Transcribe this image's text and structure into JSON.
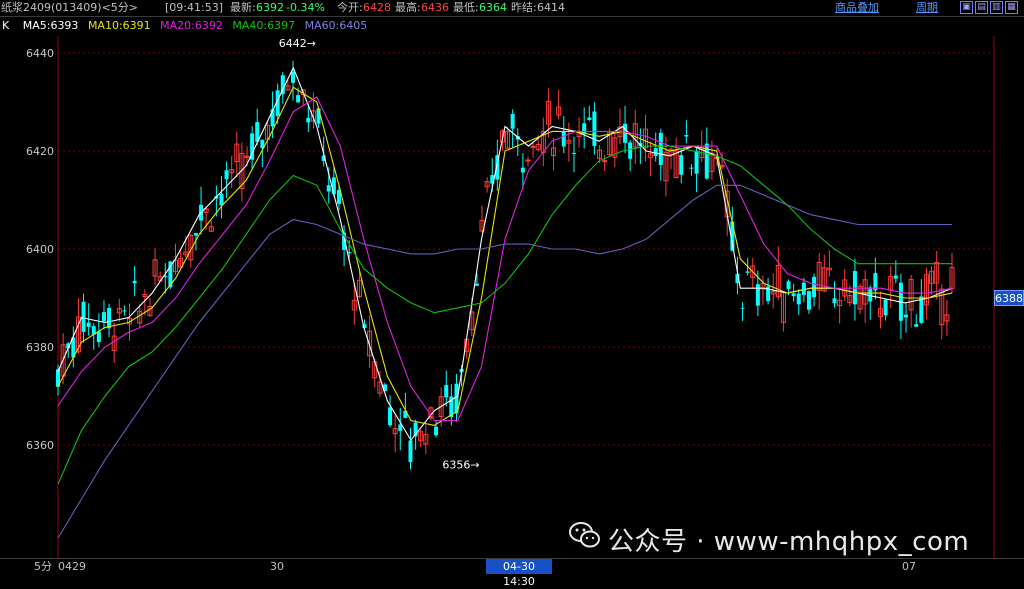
{
  "header": {
    "symbol": "纸浆2409(013409)<5分>",
    "time": "[09:41:53]",
    "latest_label": "最新:",
    "latest_value": "6392",
    "change": "-0.34%",
    "open_label": "今开:",
    "open_value": "6428",
    "high_label": "最高:",
    "high_value": "6436",
    "low_label": "最低:",
    "low_value": "6364",
    "prev_label": "昨结:",
    "prev_value": "6414",
    "overlay_link": "商品叠加",
    "period_link": "周期"
  },
  "legend": {
    "k": "K",
    "ma5": "MA5:6393",
    "ma10": "MA10:6391",
    "ma20": "MA20:6392",
    "ma40": "MA40:6397",
    "ma60": "MA60:6405"
  },
  "colors": {
    "up": "#ff3b3b",
    "down": "#00ffff",
    "ma5": "#ffffff",
    "ma10": "#e6e600",
    "ma20": "#e020e0",
    "ma40": "#10c010",
    "ma60": "#6060c0",
    "grid": "#7a0000"
  },
  "annotations": {
    "high": "6442",
    "low": "6356"
  },
  "current_price": "6388",
  "bottom": {
    "period": "5分",
    "date1": "0429",
    "date2": "30",
    "crosshair_time": "04-30 14:30",
    "date3": "07"
  },
  "watermark": "公众号 · www-mhqhpx_com",
  "chart_data": {
    "type": "line",
    "title": "",
    "yticks": [
      6360,
      6380,
      6400,
      6420,
      6440
    ],
    "ylim": [
      6335,
      6462
    ],
    "x": [
      0,
      25,
      50,
      75,
      100,
      125,
      150,
      175,
      200,
      225,
      250,
      275,
      300,
      325,
      350,
      375,
      400,
      425,
      450,
      475,
      500,
      525,
      550,
      575,
      600,
      625,
      650,
      675,
      700,
      725,
      750,
      775,
      800,
      825,
      850,
      875,
      900,
      925,
      950
    ],
    "series": [
      {
        "name": "MA5",
        "values": [
          6375,
          6386,
          6385,
          6386,
          6391,
          6398,
          6407,
          6412,
          6417,
          6427,
          6437,
          6425,
          6406,
          6384,
          6369,
          6361,
          6367,
          6370,
          6402,
          6425,
          6421,
          6425,
          6424,
          6422,
          6425,
          6420,
          6419,
          6421,
          6419,
          6392,
          6392,
          6391,
          6392,
          6392,
          6391,
          6390,
          6389,
          6390,
          6392
        ]
      },
      {
        "name": "MA10",
        "values": [
          6372,
          6381,
          6384,
          6385,
          6388,
          6394,
          6403,
          6409,
          6414,
          6423,
          6433,
          6430,
          6412,
          6392,
          6374,
          6365,
          6364,
          6367,
          6390,
          6420,
          6422,
          6424,
          6424,
          6423,
          6424,
          6422,
          6420,
          6421,
          6420,
          6398,
          6393,
          6391,
          6392,
          6392,
          6391,
          6391,
          6390,
          6390,
          6391
        ]
      },
      {
        "name": "MA20",
        "values": [
          6368,
          6375,
          6380,
          6383,
          6385,
          6390,
          6397,
          6403,
          6409,
          6418,
          6428,
          6431,
          6421,
          6402,
          6385,
          6372,
          6365,
          6365,
          6376,
          6402,
          6416,
          6422,
          6424,
          6424,
          6424,
          6423,
          6421,
          6421,
          6421,
          6411,
          6401,
          6395,
          6393,
          6392,
          6392,
          6392,
          6391,
          6391,
          6392
        ]
      },
      {
        "name": "MA40",
        "values": [
          6352,
          6363,
          6370,
          6376,
          6379,
          6384,
          6390,
          6396,
          6403,
          6410,
          6415,
          6413,
          6404,
          6396,
          6392,
          6389,
          6387,
          6388,
          6389,
          6393,
          6399,
          6407,
          6413,
          6418,
          6420,
          6421,
          6421,
          6420,
          6419,
          6417,
          6413,
          6409,
          6404,
          6400,
          6397,
          6397,
          6397,
          6397,
          6397
        ]
      },
      {
        "name": "MA60",
        "values": [
          6341,
          6349,
          6357,
          6364,
          6371,
          6378,
          6385,
          6391,
          6397,
          6403,
          6406,
          6405,
          6403,
          6401,
          6400,
          6399,
          6399,
          6400,
          6400,
          6401,
          6401,
          6400,
          6400,
          6399,
          6400,
          6402,
          6406,
          6410,
          6413,
          6413,
          6411,
          6409,
          6407,
          6406,
          6405,
          6405,
          6405,
          6405,
          6405
        ]
      }
    ]
  }
}
